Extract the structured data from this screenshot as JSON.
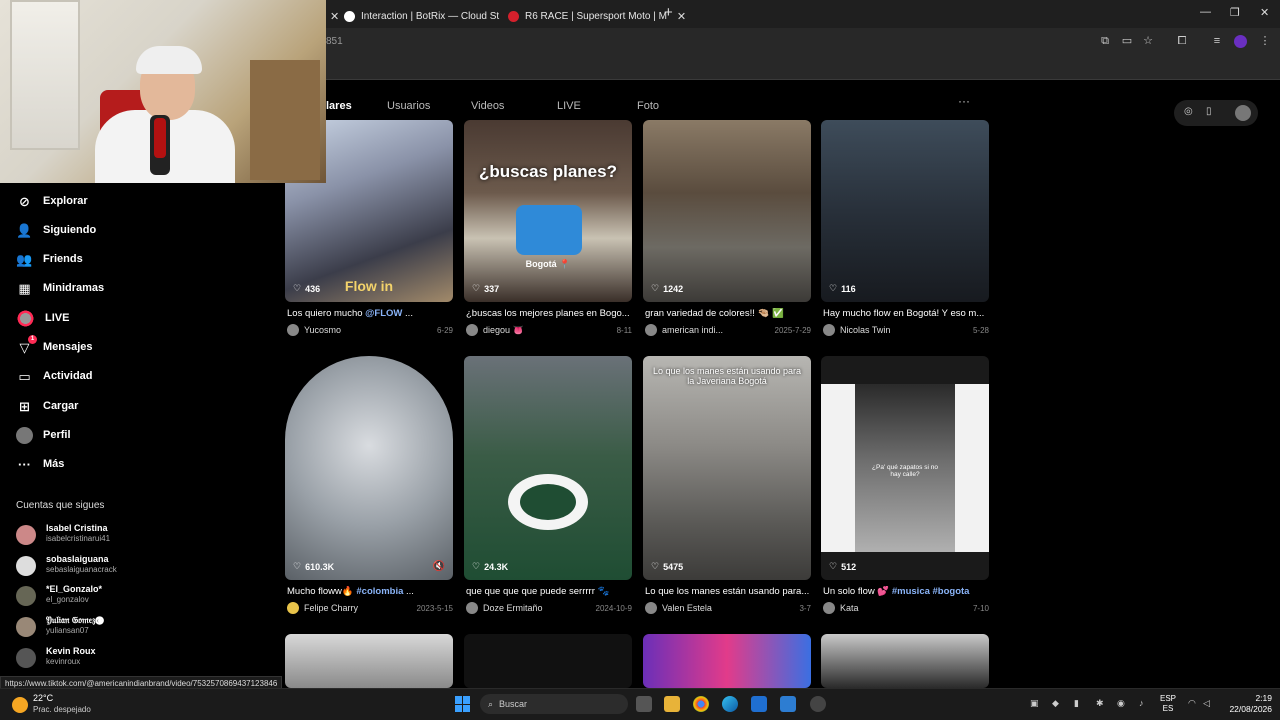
{
  "browser": {
    "tabs": [
      {
        "title": "Interaction | BotRix — Cloud St",
        "icon": "botrix-icon"
      },
      {
        "title": "R6 RACE | Supersport Moto | M",
        "icon": "r6-race-icon"
      }
    ],
    "url_fragment": "851"
  },
  "page_tabs": [
    "lares",
    "Usuarios",
    "Videos",
    "LIVE",
    "Foto"
  ],
  "sidebar": {
    "nav": [
      {
        "label": "Explorar",
        "icon": "compass-icon"
      },
      {
        "label": "Siguiendo",
        "icon": "following-icon"
      },
      {
        "label": "Friends",
        "icon": "friends-icon"
      },
      {
        "label": "Minidramas",
        "icon": "film-icon"
      },
      {
        "label": "LIVE",
        "icon": "live-icon"
      },
      {
        "label": "Mensajes",
        "icon": "messages-icon",
        "badge": "1"
      },
      {
        "label": "Actividad",
        "icon": "activity-icon"
      },
      {
        "label": "Cargar",
        "icon": "upload-icon"
      },
      {
        "label": "Perfil",
        "icon": "profile-icon"
      },
      {
        "label": "Más",
        "icon": "more-icon"
      }
    ],
    "following_title": "Cuentas que sigues",
    "following": [
      {
        "name": "Isabel Cristina",
        "user": "isabelcristinarui41"
      },
      {
        "name": "sobaslaiguana",
        "user": "sebaslaiguanacrack"
      },
      {
        "name": "*El_Gonzalo*",
        "user": "el_gonzalov"
      },
      {
        "name": "𝔜𝔲𝔩𝔦𝔞𝔫 𝔊𝔬𝔪𝔢𝔷🅒",
        "user": "yuliansan07"
      },
      {
        "name": "Kevin Roux",
        "user": "kevinroux"
      }
    ]
  },
  "videos": [
    {
      "likes": "436",
      "caption": "Los quiero mucho ",
      "tag": "@FLOW",
      "caption_end": " ...",
      "author": "Yucosmo",
      "date": "6-29",
      "overlay": "Flow in"
    },
    {
      "likes": "337",
      "caption": "¿buscas los mejores planes en Bogo...",
      "author": "diegou 👅",
      "date": "8-11",
      "overlay": "¿buscas planes?",
      "overlay2": "Bogotá 📍"
    },
    {
      "likes": "1242",
      "caption": "gran variedad de colores!! 🤏🏼 ✅",
      "author": "american indi...",
      "date": "2025-7-29"
    },
    {
      "likes": "116",
      "caption": "Hay mucho flow en Bogotá! Y eso m...",
      "author": "Nicolas Twin",
      "date": "5-28"
    },
    {
      "likes": "610.3K",
      "caption": "Mucho floww🔥 ",
      "tag": "#colombia",
      "caption_end": " ...",
      "author": "Felipe Charry",
      "date": "2023-5-15"
    },
    {
      "likes": "24.3K",
      "caption": "que que que que puede serrrrr 🐾",
      "author": "Doze Ermitaño",
      "date": "2024-10-9"
    },
    {
      "likes": "5475",
      "caption": "Lo que los manes están usando para...",
      "author": "Valen Estela",
      "date": "3-7",
      "overlay": "Lo que los manes están usando para la Javeriana Bogotá"
    },
    {
      "likes": "512",
      "caption": "Un solo flow 💕 ",
      "tag": "#musica #bogota",
      "caption_end": "",
      "author": "Kata",
      "date": "7-10",
      "overlay": "¿Pa' qué zapatos si no hay calle?"
    }
  ],
  "status_url": "https://www.tiktok.com/@americanindianbrand/video/7532570869437123846",
  "taskbar": {
    "weather_temp": "22°C",
    "weather_desc": "Prac. despejado",
    "search_placeholder": "Buscar",
    "lang_top": "ESP",
    "lang_bottom": "ES",
    "time": "2:19",
    "date": "22/08/2026"
  },
  "colors": {
    "accent": "#fe2c55",
    "hashtag": "#8ab4f8",
    "background": "#000000"
  }
}
